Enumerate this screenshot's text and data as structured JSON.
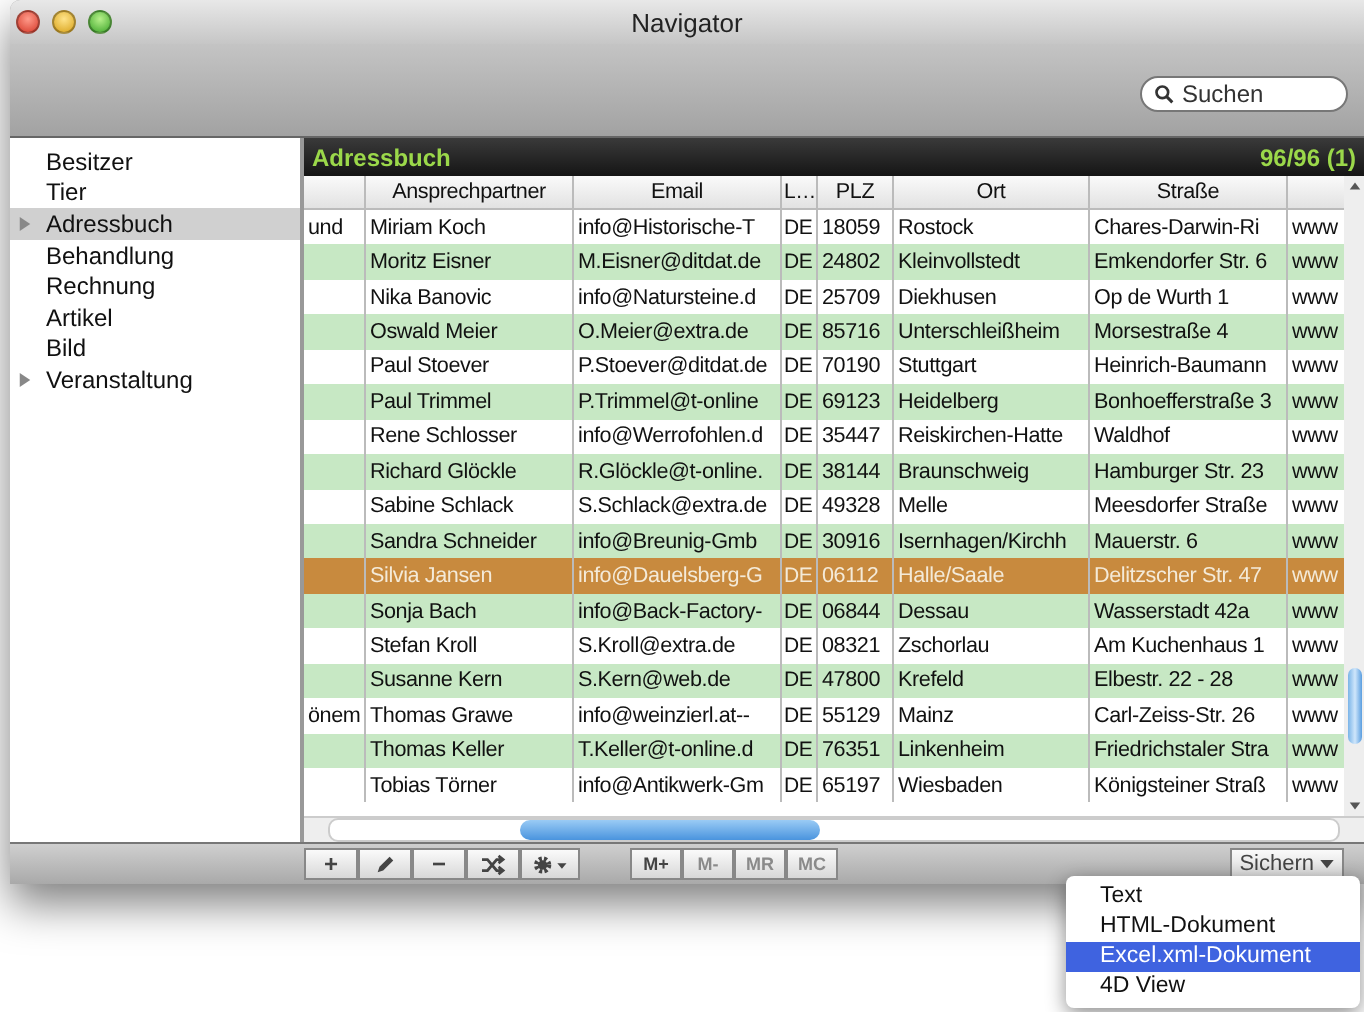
{
  "window": {
    "title": "Navigator"
  },
  "search": {
    "placeholder": "Suchen"
  },
  "sidebar": {
    "items": [
      {
        "label": "Besitzer",
        "expandable": false,
        "selected": false
      },
      {
        "label": "Tier",
        "expandable": false,
        "selected": false
      },
      {
        "label": "Adressbuch",
        "expandable": true,
        "selected": true
      },
      {
        "label": "Behandlung",
        "expandable": false,
        "selected": false
      },
      {
        "label": "Rechnung",
        "expandable": false,
        "selected": false
      },
      {
        "label": "Artikel",
        "expandable": false,
        "selected": false
      },
      {
        "label": "Bild",
        "expandable": false,
        "selected": false
      },
      {
        "label": "Veranstaltung",
        "expandable": true,
        "selected": false
      }
    ]
  },
  "table": {
    "title": "Adressbuch",
    "count": "96/96 (1)",
    "columns": [
      "Ansprechpartner",
      "Email",
      "L…",
      "PLZ",
      "Ort",
      "Straße"
    ],
    "rows": [
      {
        "column_1": "und",
        "name": "Miriam Koch",
        "email": "info@Historische-T",
        "country": "DE",
        "plz": "18059",
        "ort": "Rostock",
        "street": "Chares-Darwin-Ri",
        "column_8": "www",
        "selected": false
      },
      {
        "name": "Moritz Eisner",
        "email": "M.Eisner@ditdat.de",
        "country": "DE",
        "plz": "24802",
        "ort": "Kleinvollstedt",
        "street": "Emkendorfer Str. 6",
        "column_8": "www",
        "selected": false
      },
      {
        "name": "Nika Banovic",
        "email": "info@Natursteine.d",
        "country": "DE",
        "plz": "25709",
        "ort": "Diekhusen",
        "street": "Op de Wurth 1",
        "column_8": "www",
        "selected": false
      },
      {
        "name": "Oswald Meier",
        "email": "O.Meier@extra.de",
        "country": "DE",
        "plz": "85716",
        "ort": "Unterschleißheim",
        "street": "Morsestraße 4",
        "column_8": "www",
        "selected": false
      },
      {
        "name": "Paul Stoever",
        "email": "P.Stoever@ditdat.de",
        "country": "DE",
        "plz": "70190",
        "ort": "Stuttgart",
        "street": "Heinrich-Baumann",
        "column_8": "www",
        "selected": false
      },
      {
        "name": "Paul Trimmel",
        "email": "P.Trimmel@t-online",
        "country": "DE",
        "plz": "69123",
        "ort": "Heidelberg",
        "street": "Bonhoefferstraße 3",
        "column_8": "www",
        "selected": false
      },
      {
        "name": "Rene Schlosser",
        "email": "info@Werrofohlen.d",
        "country": "DE",
        "plz": "35447",
        "ort": "Reiskirchen-Hatte",
        "street": "Waldhof",
        "column_8": "www",
        "selected": false
      },
      {
        "name": "Richard Glöckle",
        "email": "R.Glöckle@t-online.",
        "country": "DE",
        "plz": "38144",
        "ort": "Braunschweig",
        "street": "Hamburger Str. 23",
        "column_8": "www",
        "selected": false
      },
      {
        "name": "Sabine Schlack",
        "email": "S.Schlack@extra.de",
        "country": "DE",
        "plz": "49328",
        "ort": "Melle",
        "street": "Meesdorfer Straße",
        "column_8": "www",
        "selected": false
      },
      {
        "name": "Sandra Schneider",
        "email": "info@Breunig-Gmb",
        "country": "DE",
        "plz": "30916",
        "ort": "Isernhagen/Kirchh",
        "street": "Mauerstr. 6",
        "column_8": "www",
        "selected": false
      },
      {
        "name": "Silvia Jansen",
        "email": "info@Dauelsberg-G",
        "country": "DE",
        "plz": "06112",
        "ort": "Halle/Saale",
        "street": "Delitzscher Str. 47",
        "column_8": "www",
        "selected": true
      },
      {
        "name": "Sonja Bach",
        "email": "info@Back-Factory-",
        "country": "DE",
        "plz": "06844",
        "ort": "Dessau",
        "street": "Wasserstadt 42a",
        "column_8": "www",
        "selected": false
      },
      {
        "name": "Stefan Kroll",
        "email": "S.Kroll@extra.de",
        "country": "DE",
        "plz": "08321",
        "ort": "Zschorlau",
        "street": "Am Kuchenhaus 1",
        "column_8": "www",
        "selected": false
      },
      {
        "name": "Susanne Kern",
        "email": "S.Kern@web.de",
        "country": "DE",
        "plz": "47800",
        "ort": "Krefeld",
        "street": "Elbestr. 22 - 28",
        "column_8": "www",
        "selected": false
      },
      {
        "column_1": "önem",
        "name": "Thomas Grawe",
        "email": "info@weinzierl.at--",
        "country": "DE",
        "plz": "55129",
        "ort": "Mainz",
        "street": "Carl-Zeiss-Str. 26",
        "column_8": "www",
        "selected": false
      },
      {
        "name": "Thomas Keller",
        "email": "T.Keller@t-online.d",
        "country": "DE",
        "plz": "76351",
        "ort": "Linkenheim",
        "street": "Friedrichstaler Stra",
        "column_8": "www",
        "selected": false
      },
      {
        "name": "Tobias Törner",
        "email": "info@Antikwerk-Gm",
        "country": "DE",
        "plz": "65197",
        "ort": "Wiesbaden",
        "street": "Königsteiner Straß",
        "column_8": "www",
        "selected": false
      }
    ]
  },
  "toolbar": {
    "buttons": [
      {
        "kind": "plus",
        "label": "+"
      },
      {
        "kind": "pencil"
      },
      {
        "kind": "minus",
        "label": "−"
      },
      {
        "kind": "shuffle"
      },
      {
        "kind": "gear"
      }
    ],
    "memory": [
      {
        "label": "M+",
        "disabled": false
      },
      {
        "label": "M-",
        "disabled": true
      },
      {
        "label": "MR",
        "disabled": true
      },
      {
        "label": "MC",
        "disabled": true
      }
    ],
    "save": {
      "label": "Sichern"
    }
  },
  "menu": {
    "items": [
      {
        "label": "Text",
        "selected": false
      },
      {
        "label": "HTML-Dokument",
        "selected": false
      },
      {
        "label": "Excel.xml-Dokument",
        "selected": true
      },
      {
        "label": "4D View",
        "selected": false
      }
    ]
  }
}
